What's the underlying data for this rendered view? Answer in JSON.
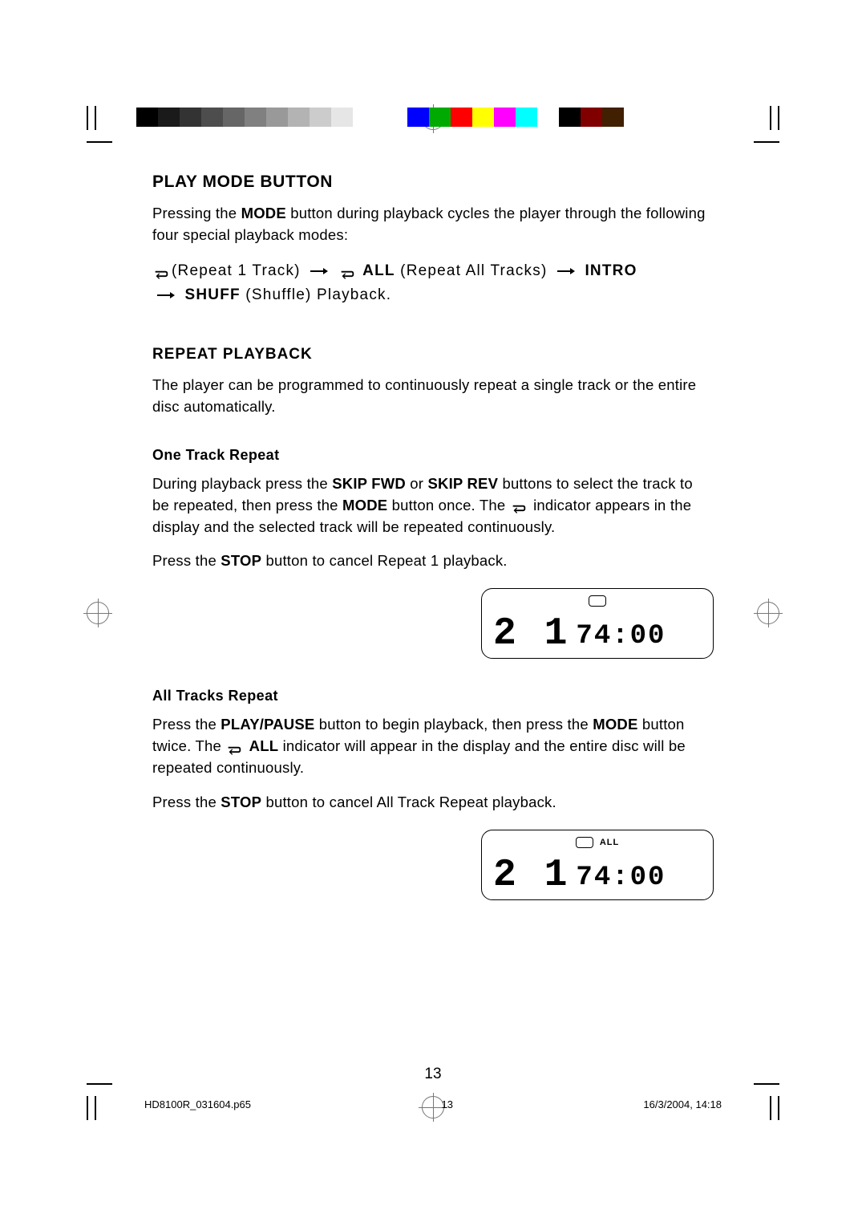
{
  "headings": {
    "play_mode": "PLAY MODE BUTTON",
    "repeat_playback": "REPEAT PLAYBACK",
    "one_track": "One Track Repeat",
    "all_tracks": "All Tracks Repeat"
  },
  "intro_text": {
    "p1a": "Pressing the ",
    "p1_mode": "MODE",
    "p1b": " button during playback cycles the player through the following four special playback modes:"
  },
  "modes": {
    "repeat1": "(Repeat 1 Track)",
    "all_bold": "ALL",
    "all_rest": " (Repeat All Tracks)",
    "intro": "INTRO",
    "shuff": "SHUFF",
    "shuff_rest": " (Shuffle) Playback."
  },
  "repeat_intro": "The player can be programmed to continuously repeat a single track or the entire disc automatically.",
  "one_track": {
    "p1a": "During playback press the ",
    "skip_fwd": "SKIP FWD",
    "p1b": " or ",
    "skip_rev": "SKIP REV",
    "p1c": " buttons to select the track to be repeated, then press the ",
    "mode": "MODE",
    "p1d": " button once. The ",
    "p1e": " indicator appears in the display and the selected track will be repeated continuously.",
    "p2a": "Press the ",
    "stop": "STOP",
    "p2b": " button to cancel Repeat 1 playback."
  },
  "all_tracks": {
    "p1a": "Press the ",
    "playpause": "PLAY/PAUSE",
    "p1b": " button to begin playback, then press the ",
    "mode": "MODE",
    "p1c": " button twice. The ",
    "all_bold": "ALL",
    "p1d": " indicator will appear in the display and the entire disc will be repeated continuously.",
    "p2a": "Press the ",
    "stop": "STOP",
    "p2b": " button to cancel All Track Repeat playback."
  },
  "lcd": {
    "track_small": "2 1",
    "time": "74:00",
    "all_label": "ALL"
  },
  "page_number": "13",
  "footer": {
    "file": "HD8100R_031604.p65",
    "page": "13",
    "datetime": "16/3/2004, 14:18"
  }
}
